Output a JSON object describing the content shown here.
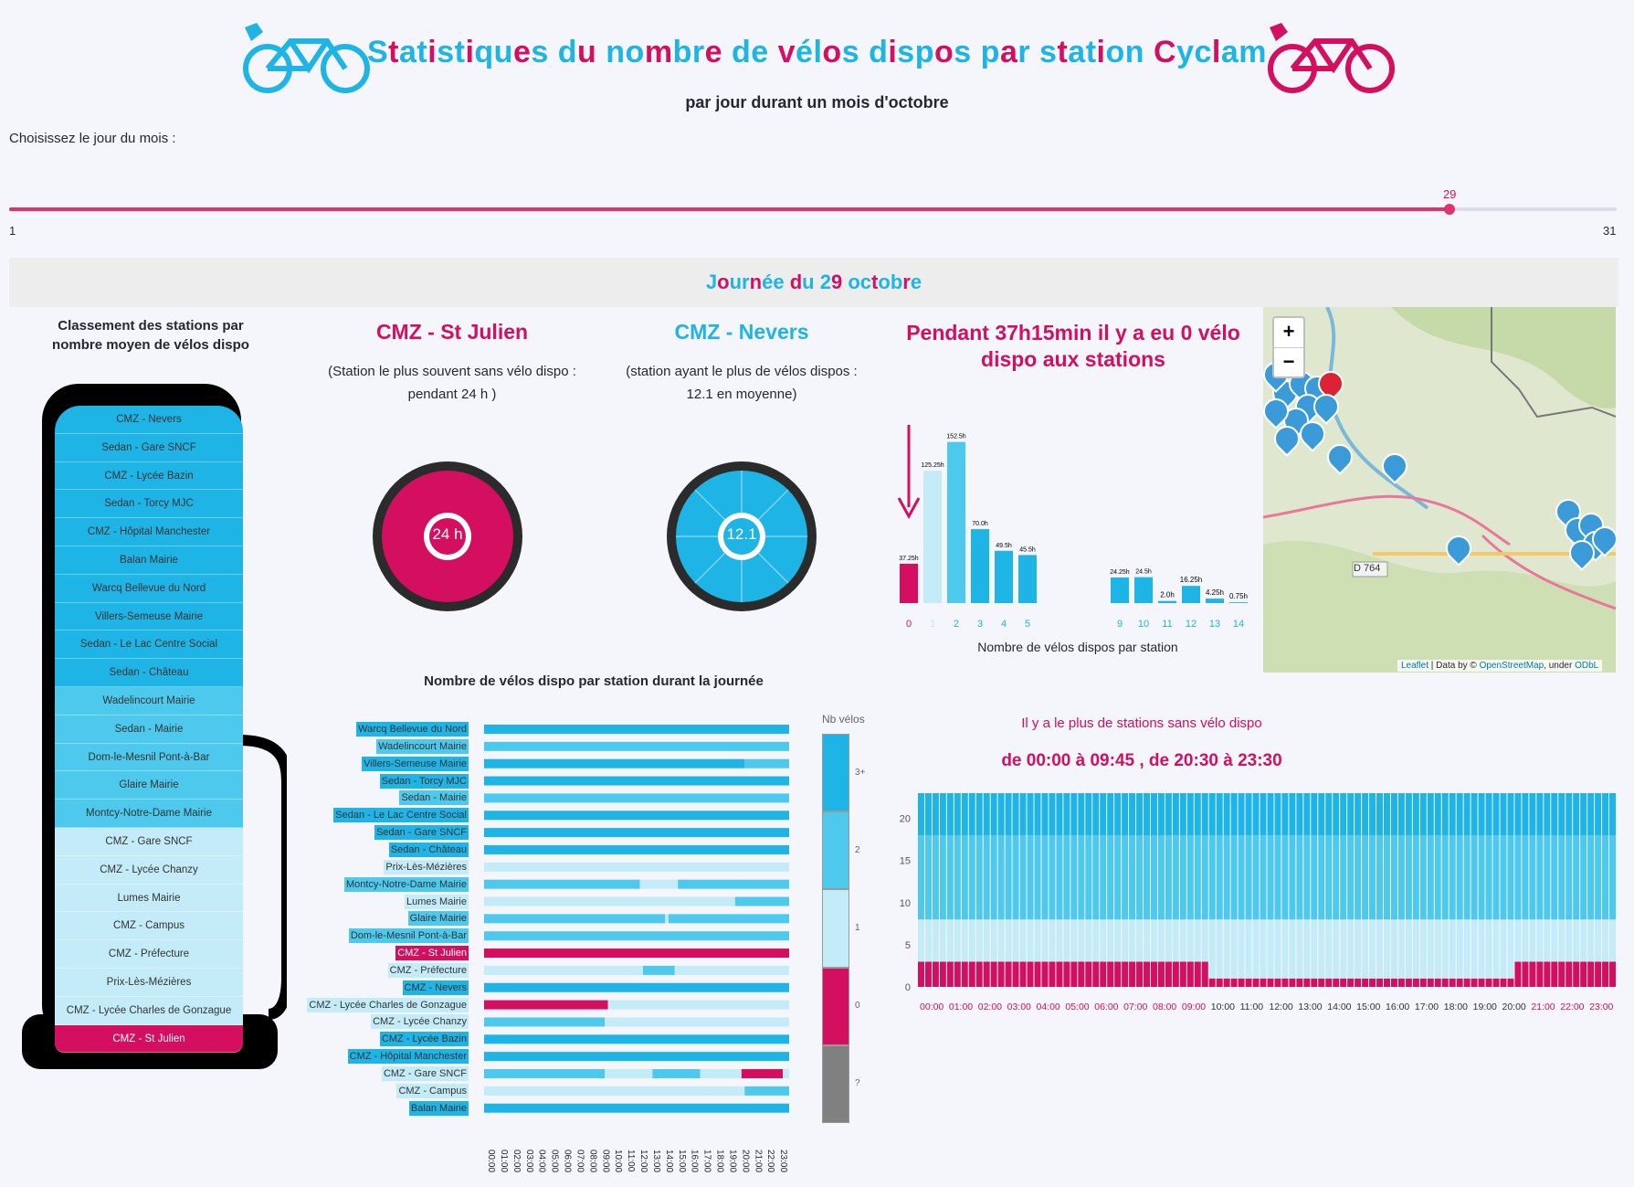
{
  "header": {
    "title": "Statistiques du nombre de vélos dispos par station Cyclam",
    "subtitle": "par jour durant un mois d'octobre",
    "left_icon": "electric-bike-icon",
    "right_icon": "electric-bike-icon",
    "colors": {
      "blue": "#1eb4e6",
      "pink": "#d40f60"
    }
  },
  "day_slider": {
    "label": "Choisissez le jour du mois :",
    "min": "1",
    "max": "31",
    "value": "29",
    "value_num": 29
  },
  "day_banner": "Journée du 29 octobre",
  "ranking": {
    "title": "Classement des stations par nombre moyen de vélos dispo",
    "items": [
      {
        "name": "CMZ - Nevers",
        "level": "3"
      },
      {
        "name": "Sedan - Gare SNCF",
        "level": "3"
      },
      {
        "name": "CMZ - Lycée Bazin",
        "level": "3"
      },
      {
        "name": "Sedan - Torcy MJC",
        "level": "3"
      },
      {
        "name": "CMZ - Hôpital Manchester",
        "level": "3"
      },
      {
        "name": "Balan Mairie",
        "level": "3"
      },
      {
        "name": "Warcq Bellevue du Nord",
        "level": "3"
      },
      {
        "name": "Villers-Semeuse Mairie",
        "level": "3"
      },
      {
        "name": "Sedan - Le Lac Centre Social",
        "level": "3"
      },
      {
        "name": "Sedan - Château",
        "level": "3"
      },
      {
        "name": "Wadelincourt Mairie",
        "level": "2"
      },
      {
        "name": "Sedan - Mairie",
        "level": "2"
      },
      {
        "name": "Dom-le-Mesnil Pont-à-Bar",
        "level": "2"
      },
      {
        "name": "Glaire Mairie",
        "level": "2"
      },
      {
        "name": "Montcy-Notre-Dame Mairie",
        "level": "2"
      },
      {
        "name": "CMZ - Gare SNCF",
        "level": "1"
      },
      {
        "name": "CMZ - Lycée Chanzy",
        "level": "1"
      },
      {
        "name": "Lumes Mairie",
        "level": "1"
      },
      {
        "name": "CMZ - Campus",
        "level": "1"
      },
      {
        "name": "CMZ - Préfecture",
        "level": "1"
      },
      {
        "name": "Prix-Lès-Mézières",
        "level": "1"
      },
      {
        "name": "CMZ - Lycée Charles de Gonzague",
        "level": "1"
      },
      {
        "name": "CMZ - St Julien",
        "level": "0"
      }
    ]
  },
  "card_empty": {
    "station": "CMZ - St Julien",
    "line1": "(Station le plus souvent sans vélo dispo :",
    "line2": "pendant 24 h )",
    "badge": "24 h"
  },
  "card_full": {
    "station": "CMZ - Nevers",
    "line1": "(station ayant le plus de vélos dispos :",
    "line2": "12.1 en moyenne)",
    "badge": "12.1"
  },
  "histogram": {
    "title": "Pendant 37h15min il y a eu 0 vélo dispo aux stations",
    "xlabel": "Nombre de vélos dispos par station",
    "chart_data": {
      "type": "bar",
      "categories": [
        "0",
        "1",
        "2",
        "3",
        "4",
        "5",
        "9",
        "10",
        "11",
        "12",
        "13",
        "14"
      ],
      "values": [
        37.25,
        125.25,
        152.5,
        70.0,
        49.5,
        45.5,
        24.25,
        24.5,
        2.0,
        16.25,
        4.25,
        0.75
      ],
      "labels": [
        "37.25h",
        "125.25h",
        "152.5h",
        "70.0h",
        "49.5h",
        "45.5h",
        "24.25h",
        "24.5h",
        "2.0h",
        "16.25h",
        "4.25h",
        "0.75h"
      ],
      "colors": [
        "#d40f60",
        "#c4ecf8",
        "#4cc9ec",
        "#1eb4e6",
        "#1eb4e6",
        "#1eb4e6",
        "#1eb4e6",
        "#1eb4e6",
        "#1eb4e6",
        "#1eb4e6",
        "#1eb4e6",
        "#1eb4e6"
      ]
    }
  },
  "grid": {
    "title": "Nombre de vélos dispo par station durant la journée",
    "legend_title": "Nb vélos",
    "legend_labels": [
      "3+",
      "2",
      "1",
      "0",
      "?"
    ],
    "legend_colors": [
      "#1eb4e6",
      "#4cc9ec",
      "#c4ecf8",
      "#d40f60",
      "#808080"
    ],
    "hours": [
      "00:00",
      "01:00",
      "02:00",
      "03:00",
      "04:00",
      "05:00",
      "06:00",
      "07:00",
      "08:00",
      "09:00",
      "10:00",
      "11:00",
      "12:00",
      "13:00",
      "14:00",
      "15:00",
      "16:00",
      "17:00",
      "18:00",
      "19:00",
      "20:00",
      "21:00",
      "22:00",
      "23:00"
    ],
    "rows": [
      {
        "name": "Warcq Bellevue du Nord",
        "segments": [
          [
            0,
            24,
            3
          ]
        ]
      },
      {
        "name": "Wadelincourt Mairie",
        "segments": [
          [
            0,
            24,
            2
          ]
        ]
      },
      {
        "name": "Villers-Semeuse Mairie",
        "segments": [
          [
            0,
            20.5,
            3
          ],
          [
            20.5,
            24,
            2
          ]
        ]
      },
      {
        "name": "Sedan - Torcy MJC",
        "segments": [
          [
            0,
            24,
            3
          ]
        ]
      },
      {
        "name": "Sedan - Mairie",
        "segments": [
          [
            0,
            24,
            2
          ]
        ]
      },
      {
        "name": "Sedan - Le Lac Centre Social",
        "segments": [
          [
            0,
            24,
            3
          ]
        ]
      },
      {
        "name": "Sedan - Gare SNCF",
        "segments": [
          [
            0,
            24,
            3
          ]
        ]
      },
      {
        "name": "Sedan - Château",
        "segments": [
          [
            0,
            24,
            3
          ]
        ]
      },
      {
        "name": "Prix-Lès-Mézières",
        "segments": [
          [
            0,
            24,
            1
          ]
        ]
      },
      {
        "name": "Montcy-Notre-Dame Mairie",
        "segments": [
          [
            0,
            12.25,
            2
          ],
          [
            12.25,
            15.25,
            1
          ],
          [
            15.25,
            24,
            2
          ]
        ]
      },
      {
        "name": "Lumes Mairie",
        "segments": [
          [
            0,
            19.75,
            1
          ],
          [
            19.75,
            24,
            2
          ]
        ]
      },
      {
        "name": "Glaire Mairie",
        "segments": [
          [
            0,
            14.25,
            2
          ],
          [
            14.25,
            14.5,
            1
          ],
          [
            14.5,
            24,
            2
          ]
        ]
      },
      {
        "name": "Dom-le-Mesnil Pont-à-Bar",
        "segments": [
          [
            0,
            24,
            2
          ]
        ]
      },
      {
        "name": "CMZ - St Julien",
        "segments": [
          [
            0,
            24,
            0
          ]
        ]
      },
      {
        "name": "CMZ - Préfecture",
        "segments": [
          [
            0,
            12.5,
            1
          ],
          [
            12.5,
            15,
            2
          ],
          [
            15,
            24,
            1
          ]
        ]
      },
      {
        "name": "CMZ - Nevers",
        "segments": [
          [
            0,
            24,
            3
          ]
        ]
      },
      {
        "name": "CMZ - Lycée Charles de Gonzague",
        "segments": [
          [
            0,
            9.75,
            0
          ],
          [
            9.75,
            24,
            1
          ]
        ]
      },
      {
        "name": "CMZ - Lycée Chanzy",
        "segments": [
          [
            0,
            9.5,
            2
          ],
          [
            9.5,
            24,
            1
          ]
        ]
      },
      {
        "name": "CMZ - Lycée Bazin",
        "segments": [
          [
            0,
            24,
            3
          ]
        ]
      },
      {
        "name": "CMZ - Hôpital Manchester",
        "segments": [
          [
            0,
            24,
            3
          ]
        ]
      },
      {
        "name": "CMZ - Gare SNCF",
        "segments": [
          [
            0,
            9.5,
            2
          ],
          [
            9.5,
            13.25,
            1
          ],
          [
            13.25,
            17,
            2
          ],
          [
            17,
            20.25,
            1
          ],
          [
            20.25,
            23.5,
            0
          ],
          [
            23.5,
            24,
            1
          ]
        ]
      },
      {
        "name": "CMZ - Campus",
        "segments": [
          [
            0,
            20.5,
            1
          ],
          [
            20.5,
            24,
            2
          ]
        ]
      },
      {
        "name": "Balan Mairie",
        "segments": [
          [
            0,
            24,
            3
          ]
        ]
      }
    ],
    "highlight": "CMZ - St Julien"
  },
  "stacked": {
    "title": "Il y a le plus de stations sans vélo dispo",
    "range": "de 00:00 à 09:45 , de 20:30 à 23:30",
    "y_ticks": [
      "0",
      "5",
      "10",
      "15",
      "20"
    ],
    "x_ticks": [
      "00:00",
      "01:00",
      "02:00",
      "03:00",
      "04:00",
      "05:00",
      "06:00",
      "07:00",
      "08:00",
      "09:00",
      "10:00",
      "11:00",
      "12:00",
      "13:00",
      "14:00",
      "15:00",
      "16:00",
      "17:00",
      "18:00",
      "19:00",
      "20:00",
      "21:00",
      "22:00",
      "23:00"
    ],
    "pink_ticks": [
      "00:00",
      "01:00",
      "02:00",
      "03:00",
      "04:00",
      "05:00",
      "06:00",
      "07:00",
      "08:00",
      "09:00",
      "21:00",
      "22:00",
      "23:00"
    ],
    "chart_data": {
      "type": "bar",
      "x_interval_hours": 0.25,
      "ylim": [
        0,
        23
      ],
      "series": [
        {
          "name": "0",
          "color": "#d40f60",
          "segments": [
            [
              0,
              10,
              3
            ],
            [
              10,
              20.5,
              1
            ],
            [
              20.5,
              24,
              3
            ]
          ]
        },
        {
          "name": "1",
          "color": "#c4ecf8",
          "segments": [
            [
              0,
              10,
              5
            ],
            [
              10,
              20.5,
              7
            ],
            [
              20.5,
              24,
              5
            ]
          ]
        },
        {
          "name": "2",
          "color": "#4cc9ec",
          "segments": [
            [
              0,
              24,
              10
            ]
          ]
        },
        {
          "name": "3+",
          "color": "#1eb4e6",
          "segments": [
            [
              0,
              24,
              5
            ]
          ]
        }
      ]
    }
  },
  "map": {
    "zoom_in": "+",
    "zoom_out": "−",
    "attribution_leaflet": "Leaflet",
    "attribution_mid": " | Data by © ",
    "attribution_osm": "OpenStreetMap",
    "attribution_under": ", under ",
    "attribution_odbl": "ODbL",
    "road_label": "D 764",
    "marker_icon": "bike-marker-icon"
  }
}
